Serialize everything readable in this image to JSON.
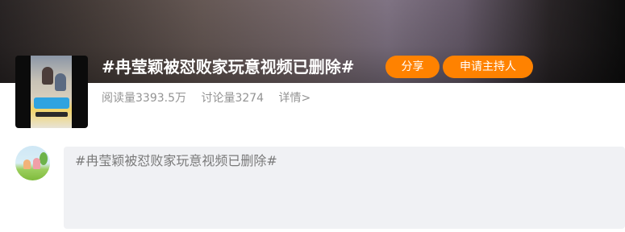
{
  "topic": {
    "title": "#冉莹颖被怼败家玩意视频已删除#",
    "share_label": "分享",
    "host_label": "申请主持人",
    "stats": {
      "reads": "阅读量3393.5万",
      "discussions": "讨论量3274",
      "details": "详情>"
    }
  },
  "composer": {
    "text": "#冉莹颖被怼败家玩意视频已删除#"
  },
  "colors": {
    "accent": "#ff8200",
    "composer_bg": "#f0f1f4",
    "meta_text": "#939393"
  }
}
